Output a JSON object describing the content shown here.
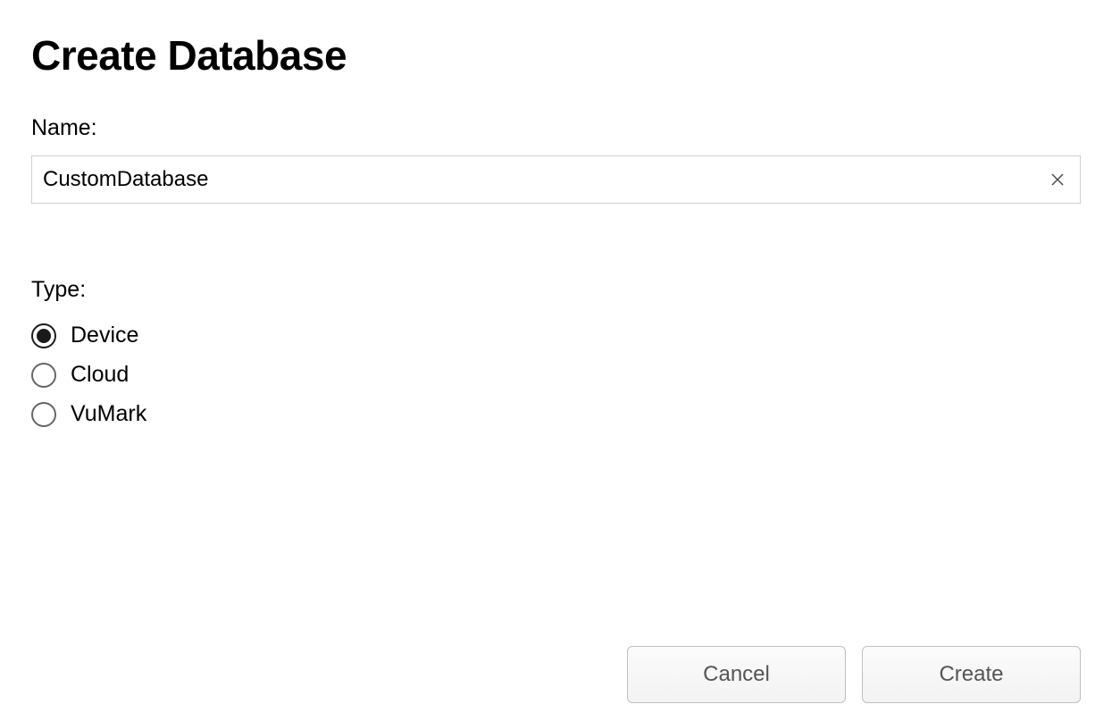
{
  "title": "Create Database",
  "nameField": {
    "label": "Name:",
    "value": "CustomDatabase"
  },
  "typeField": {
    "label": "Type:",
    "options": [
      {
        "label": "Device",
        "selected": true
      },
      {
        "label": "Cloud",
        "selected": false
      },
      {
        "label": "VuMark",
        "selected": false
      }
    ]
  },
  "buttons": {
    "cancel": "Cancel",
    "create": "Create"
  }
}
